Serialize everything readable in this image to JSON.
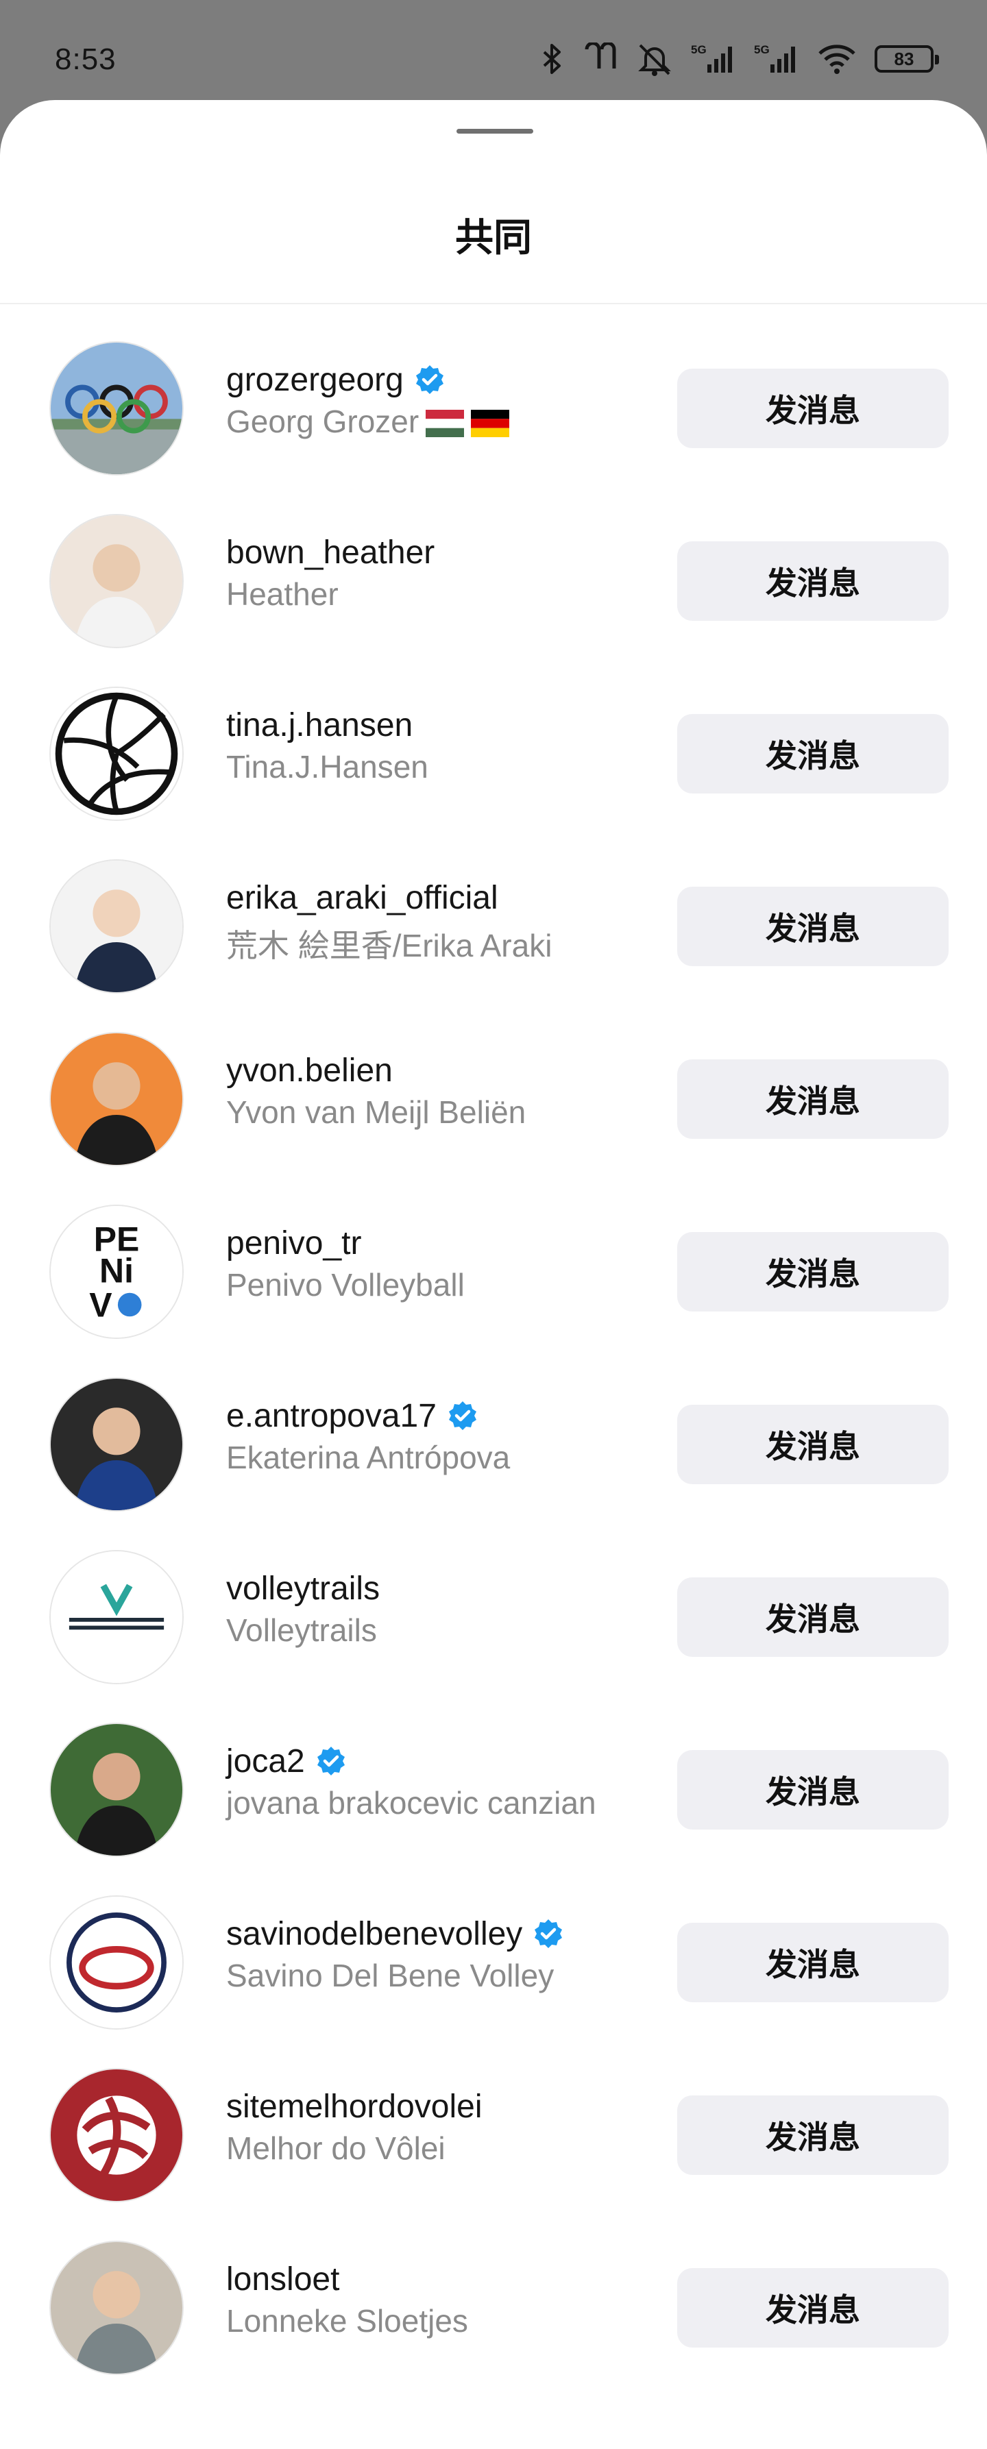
{
  "status_bar": {
    "time": "8:53",
    "battery": "83",
    "network_1": "5G",
    "network_2": "5G",
    "icons": [
      "bluetooth-icon",
      "earbuds-icon",
      "mute-icon",
      "signal-icon",
      "signal-icon",
      "wifi-icon",
      "battery-icon"
    ]
  },
  "sheet": {
    "title": "共同",
    "button_label": "发消息"
  },
  "users": [
    {
      "username": "grozergeorg",
      "full_name": "Georg Grozer",
      "verified": true,
      "flags": [
        "hungary-flag-icon",
        "germany-flag-icon"
      ],
      "avatar": "olympic-rings-avatar"
    },
    {
      "username": "bown_heather",
      "full_name": "Heather",
      "verified": false,
      "flags": [],
      "avatar": "photo-avatar"
    },
    {
      "username": "tina.j.hansen",
      "full_name": "Tina.J.Hansen",
      "verified": false,
      "flags": [],
      "avatar": "volleyball-avatar"
    },
    {
      "username": "erika_araki_official",
      "full_name": "荒木 絵里香/Erika Araki",
      "verified": false,
      "flags": [],
      "avatar": "photo-avatar"
    },
    {
      "username": "yvon.belien",
      "full_name": "Yvon van Meijl Beliën",
      "verified": false,
      "flags": [],
      "avatar": "photo-avatar"
    },
    {
      "username": "penivo_tr",
      "full_name": "Penivo Volleyball",
      "verified": false,
      "flags": [],
      "avatar": "penivo-logo-avatar"
    },
    {
      "username": "e.antropova17",
      "full_name": "Ekaterina Antrópova",
      "verified": true,
      "flags": [],
      "avatar": "photo-avatar"
    },
    {
      "username": "volleytrails",
      "full_name": "Volleytrails",
      "verified": false,
      "flags": [],
      "avatar": "volleytrails-logo-avatar"
    },
    {
      "username": "joca2",
      "full_name": "jovana brakocevic canzian",
      "verified": true,
      "flags": [],
      "avatar": "photo-avatar"
    },
    {
      "username": "savinodelbenevolley",
      "full_name": "Savino Del Bene Volley",
      "verified": true,
      "flags": [],
      "avatar": "savino-logo-avatar"
    },
    {
      "username": "sitemelhordovolei",
      "full_name": "Melhor do Vôlei",
      "verified": false,
      "flags": [],
      "avatar": "melhor-logo-avatar"
    },
    {
      "username": "lonsloet",
      "full_name": "Lonneke Sloetjes",
      "verified": false,
      "flags": [],
      "avatar": "photo-avatar"
    }
  ],
  "colors": {
    "verified_blue": "#1d9bf0",
    "button_bg": "#efeff3",
    "secondary_text": "#8a8a8a"
  }
}
